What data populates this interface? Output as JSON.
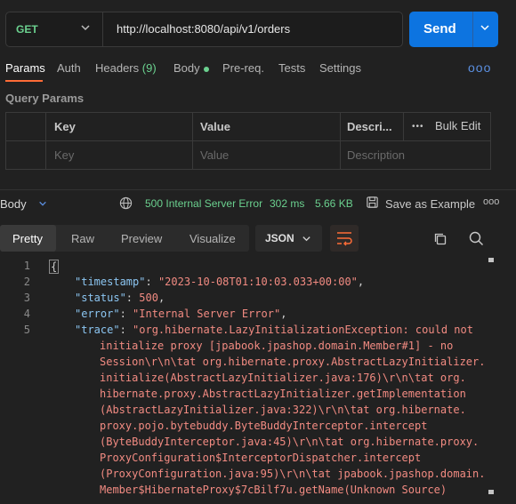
{
  "request": {
    "method": "GET",
    "url": "http://localhost:8080/api/v1/orders",
    "send_label": "Send"
  },
  "tabs": {
    "params": "Params",
    "auth": "Auth",
    "headers": "Headers",
    "headers_count": "(9)",
    "body": "Body",
    "prereq": "Pre-req.",
    "tests": "Tests",
    "settings": "Settings",
    "more": "ooo"
  },
  "query_params": {
    "title": "Query Params",
    "headers": {
      "key": "Key",
      "value": "Value",
      "description": "Descri..."
    },
    "bulk_edit": "Bulk Edit",
    "bulk_dots": "•••",
    "placeholders": {
      "key": "Key",
      "value": "Value",
      "description": "Description"
    }
  },
  "response": {
    "body_label": "Body",
    "status": "500 Internal Server Error",
    "time": "302 ms",
    "size": "5.66 KB",
    "save_example": "Save as Example",
    "more": "ooo",
    "status_color": "#6bd18f"
  },
  "view": {
    "pretty": "Pretty",
    "raw": "Raw",
    "preview": "Preview",
    "visualize": "Visualize",
    "format": "JSON"
  },
  "code": {
    "line_numbers": [
      "1",
      "2",
      "3",
      "4",
      "5"
    ],
    "brace": "{",
    "timestamp_key": "\"timestamp\"",
    "timestamp_val": "\"2023-10-08T01:10:03.033+00:00\"",
    "status_key": "\"status\"",
    "status_val": "500",
    "error_key": "\"error\"",
    "error_val": "\"Internal Server Error\"",
    "trace_key": "\"trace\"",
    "trace_lines": [
      "\"org.hibernate.LazyInitializationException: could not",
      "initialize proxy [jpabook.jpashop.domain.Member#1] - no",
      "Session\\r\\n\\tat org.hibernate.proxy.AbstractLazyInitializer.",
      "initialize(AbstractLazyInitializer.java:176)\\r\\n\\tat org.",
      "hibernate.proxy.AbstractLazyInitializer.getImplementation",
      "(AbstractLazyInitializer.java:322)\\r\\n\\tat org.hibernate.",
      "proxy.pojo.bytebuddy.ByteBuddyInterceptor.intercept",
      "(ByteBuddyInterceptor.java:45)\\r\\n\\tat org.hibernate.proxy.",
      "ProxyConfiguration$InterceptorDispatcher.intercept",
      "(ProxyConfiguration.java:95)\\r\\n\\tat jpabook.jpashop.domain.",
      "Member$HibernateProxy$7cBilf7u.getName(Unknown Source)"
    ]
  }
}
